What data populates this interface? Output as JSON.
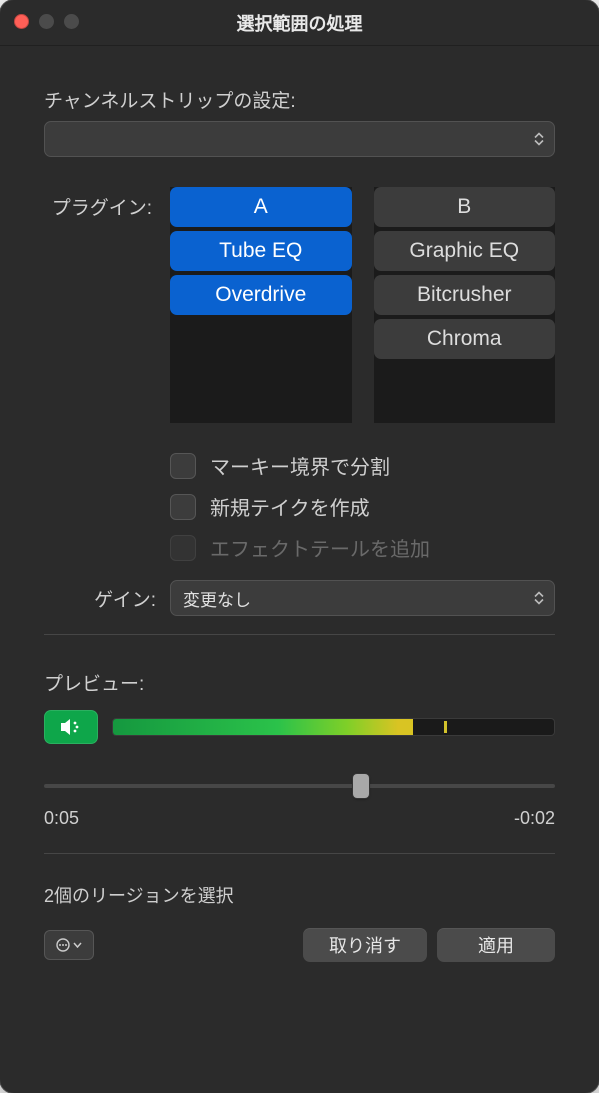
{
  "title": "選択範囲の処理",
  "channelStrip": {
    "label": "チャンネルストリップの設定:",
    "value": ""
  },
  "plugins": {
    "label": "プラグイン:",
    "colA": {
      "header": "A",
      "items": [
        "Tube EQ",
        "Overdrive"
      ]
    },
    "colB": {
      "header": "B",
      "items": [
        "Graphic EQ",
        "Bitcrusher",
        "Chroma"
      ]
    }
  },
  "options": {
    "splitMarquee": {
      "label": "マーキー境界で分割",
      "checked": false,
      "disabled": false
    },
    "newTake": {
      "label": "新規テイクを作成",
      "checked": false,
      "disabled": false
    },
    "effectTail": {
      "label": "エフェクトテールを追加",
      "checked": false,
      "disabled": true
    }
  },
  "gain": {
    "label": "ゲイン:",
    "value": "変更なし"
  },
  "preview": {
    "label": "プレビュー:",
    "meterLevel": 0.68,
    "peak": 0.75,
    "position": 0.62,
    "timeStart": "0:05",
    "timeEnd": "-0:02"
  },
  "status": "2個のリージョンを選択",
  "footer": {
    "undo": "取り消す",
    "apply": "適用"
  }
}
